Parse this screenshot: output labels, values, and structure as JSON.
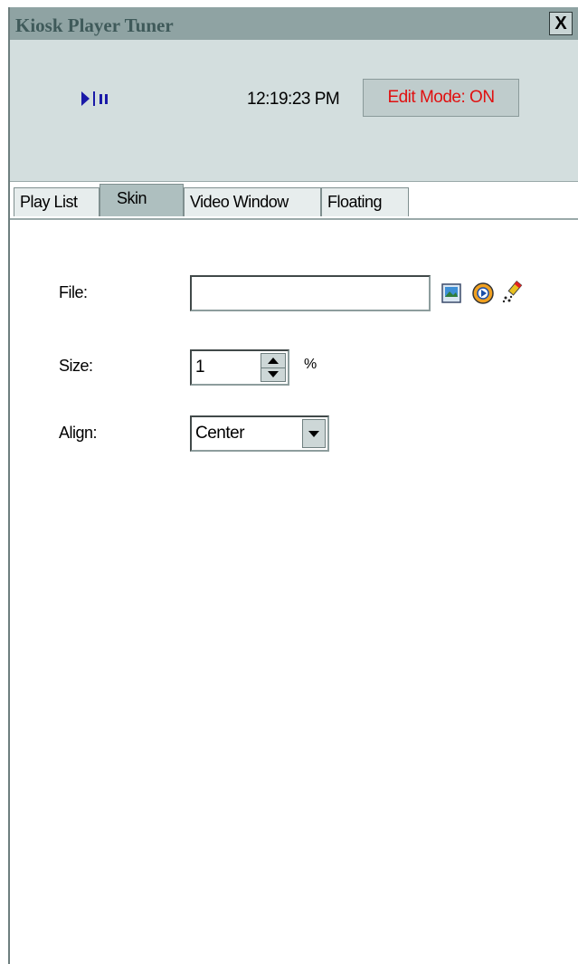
{
  "window": {
    "title": "Kiosk Player Tuner",
    "close_label": "X"
  },
  "header": {
    "play_pause_icon": "play-pause-icon",
    "clock": "12:19:23 PM",
    "edit_mode": "Edit Mode: ON"
  },
  "tabs": [
    {
      "label": "Play List",
      "active": false
    },
    {
      "label": "Skin",
      "active": true
    },
    {
      "label": "Video Window",
      "active": false
    },
    {
      "label": "Floating",
      "active": false
    }
  ],
  "skin": {
    "file_label": "File:",
    "file_value": "",
    "size_label": "Size:",
    "size_value": "1",
    "size_unit": "%",
    "align_label": "Align:",
    "align_value": "Center"
  },
  "icons": [
    "image-icon",
    "media-player-icon",
    "eraser-wand-icon"
  ],
  "colors": {
    "title_bar": "#8fa3a3",
    "header_bg": "#d3dede",
    "edit_mode_text": "#e01010",
    "play_icon": "#1a1aa8"
  }
}
